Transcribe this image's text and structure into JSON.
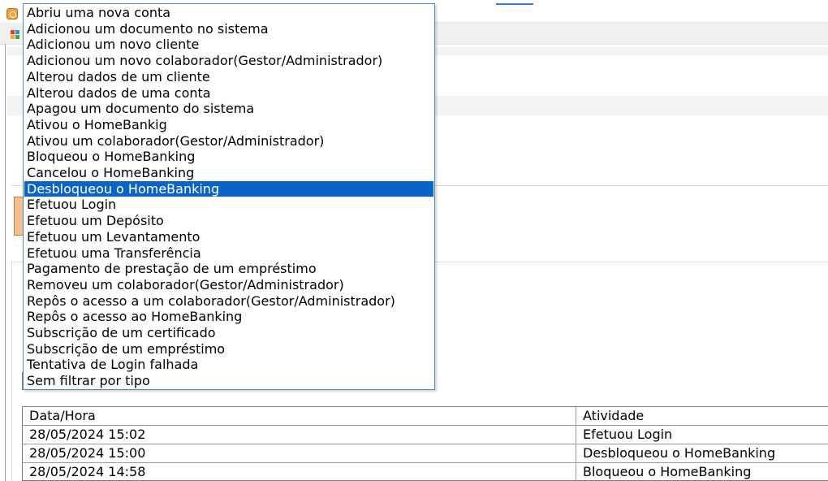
{
  "activity_filter": {
    "options": [
      "Abriu uma nova conta",
      "Adicionou um documento no sistema",
      "Adicionou um novo cliente",
      "Adicionou um novo colaborador(Gestor/Administrador)",
      "Alterou dados de um cliente",
      "Alterou dados de uma conta",
      "Apagou um documento do sistema",
      "Ativou o HomeBankig",
      "Ativou um colaborador(Gestor/Administrador)",
      "Bloqueou o HomeBanking",
      "Cancelou o HomeBanking",
      "Desbloqueou o HomeBanking",
      "Efetuou Login",
      "Efetuou um Depósito",
      "Efetuou um Levantamento",
      "Efetuou uma Transferência",
      "Pagamento de prestação de um empréstimo",
      "Removeu um colaborador(Gestor/Administrador)",
      "Repôs o acesso a um colaborador(Gestor/Administrador)",
      "Repôs o acesso ao HomeBanking",
      "Subscrição de um certificado",
      "Subscrição de um empréstimo",
      "Tentativa de Login falhada",
      "Sem filtrar por tipo"
    ],
    "highlighted_index": 11
  },
  "activity_grid": {
    "columns": {
      "datetime": "Data/Hora",
      "activity": "Atividade"
    },
    "rows": [
      {
        "datetime": "28/05/2024 15:02",
        "activity": "Efetuou Login"
      },
      {
        "datetime": "28/05/2024 15:00",
        "activity": "Desbloqueou o HomeBanking"
      },
      {
        "datetime": "28/05/2024 14:58",
        "activity": "Bloqueou o HomeBanking"
      }
    ]
  },
  "colors": {
    "highlight": "#0a64c8",
    "dropdown_border": "#4a88c9",
    "accent_button": "#f0c090"
  }
}
